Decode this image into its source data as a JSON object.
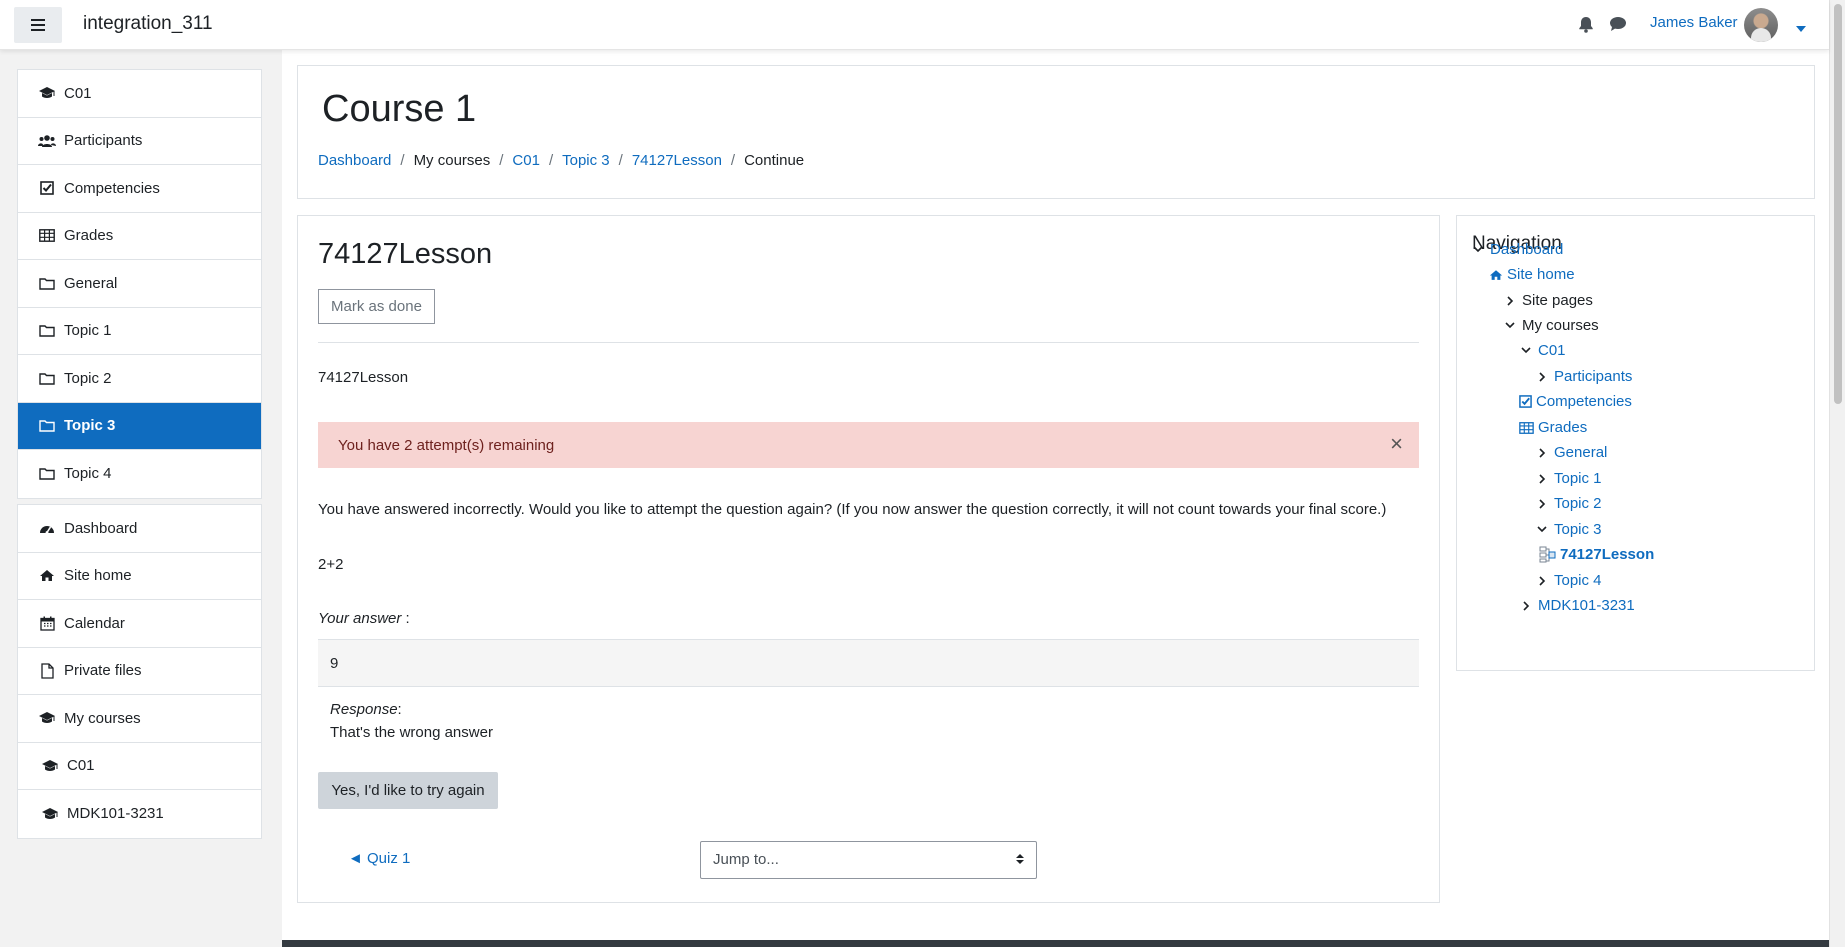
{
  "header": {
    "site_name": "integration_311",
    "user_name": "James Baker"
  },
  "drawer": {
    "course_items": [
      {
        "label": "C01",
        "icon": "graduation-cap-icon"
      },
      {
        "label": "Participants",
        "icon": "users-icon"
      },
      {
        "label": "Competencies",
        "icon": "check-square-icon"
      },
      {
        "label": "Grades",
        "icon": "table-icon"
      },
      {
        "label": "General",
        "icon": "folder-icon"
      },
      {
        "label": "Topic 1",
        "icon": "folder-icon"
      },
      {
        "label": "Topic 2",
        "icon": "folder-icon"
      },
      {
        "label": "Topic 3",
        "icon": "folder-icon",
        "active": true
      },
      {
        "label": "Topic 4",
        "icon": "folder-icon"
      }
    ],
    "site_items": [
      {
        "label": "Dashboard",
        "icon": "tachometer-icon"
      },
      {
        "label": "Site home",
        "icon": "home-icon"
      },
      {
        "label": "Calendar",
        "icon": "calendar-icon"
      },
      {
        "label": "Private files",
        "icon": "file-icon"
      },
      {
        "label": "My courses",
        "icon": "graduation-cap-icon"
      },
      {
        "label": "C01",
        "icon": "graduation-cap-icon"
      },
      {
        "label": "MDK101-3231",
        "icon": "graduation-cap-icon"
      }
    ]
  },
  "page": {
    "title": "Course 1",
    "breadcrumb": [
      "Dashboard",
      "My courses",
      "C01",
      "Topic 3",
      "74127Lesson",
      "Continue"
    ]
  },
  "lesson": {
    "title": "74127Lesson",
    "mark_done_label": "Mark as done",
    "intro": "74127Lesson",
    "alert_text": "You have 2 attempt(s) remaining",
    "alert_close": "×",
    "feedback": "You have answered incorrectly. Would you like to attempt the question again? (If you now answer the question correctly, it will not count towards your final score.)",
    "question": "2+2",
    "your_answer_label": "Your answer",
    "your_answer_suffix": " :",
    "answer_value": "9",
    "response_label": "Response",
    "response_suffix": ":",
    "response_text": "That's the wrong answer",
    "retry_label": "Yes, I'd like to try again",
    "prev_link": "◄ Quiz 1",
    "jump_placeholder": "Jump to..."
  },
  "navigation_block": {
    "title": "Navigation",
    "items": [
      {
        "label": "Dashboard",
        "expander": "expanded",
        "link": true
      },
      {
        "label": "Site home",
        "icon": "home-icon",
        "link": true
      },
      {
        "label": "Site pages",
        "expander": "collapsed",
        "link": false
      },
      {
        "label": "My courses",
        "expander": "expanded",
        "link": false
      },
      {
        "label": "C01",
        "expander": "expanded",
        "link": true
      },
      {
        "label": "Participants",
        "expander": "collapsed",
        "link": true
      },
      {
        "label": "Competencies",
        "icon": "check-square-icon",
        "link": true
      },
      {
        "label": "Grades",
        "icon": "table-icon",
        "link": true
      },
      {
        "label": "General",
        "expander": "collapsed",
        "link": true
      },
      {
        "label": "Topic 1",
        "expander": "collapsed",
        "link": true
      },
      {
        "label": "Topic 2",
        "expander": "collapsed",
        "link": true
      },
      {
        "label": "Topic 3",
        "expander": "expanded",
        "link": true
      },
      {
        "label": "74127Lesson",
        "icon": "lesson-icon",
        "link": true,
        "current": true
      },
      {
        "label": "Topic 4",
        "expander": "collapsed",
        "link": true
      },
      {
        "label": "MDK101-3231",
        "expander": "collapsed",
        "link": true
      }
    ]
  },
  "colors": {
    "brand": "#0f6cbf",
    "alert_bg": "#f7d4d2",
    "alert_text": "#6e211e"
  }
}
